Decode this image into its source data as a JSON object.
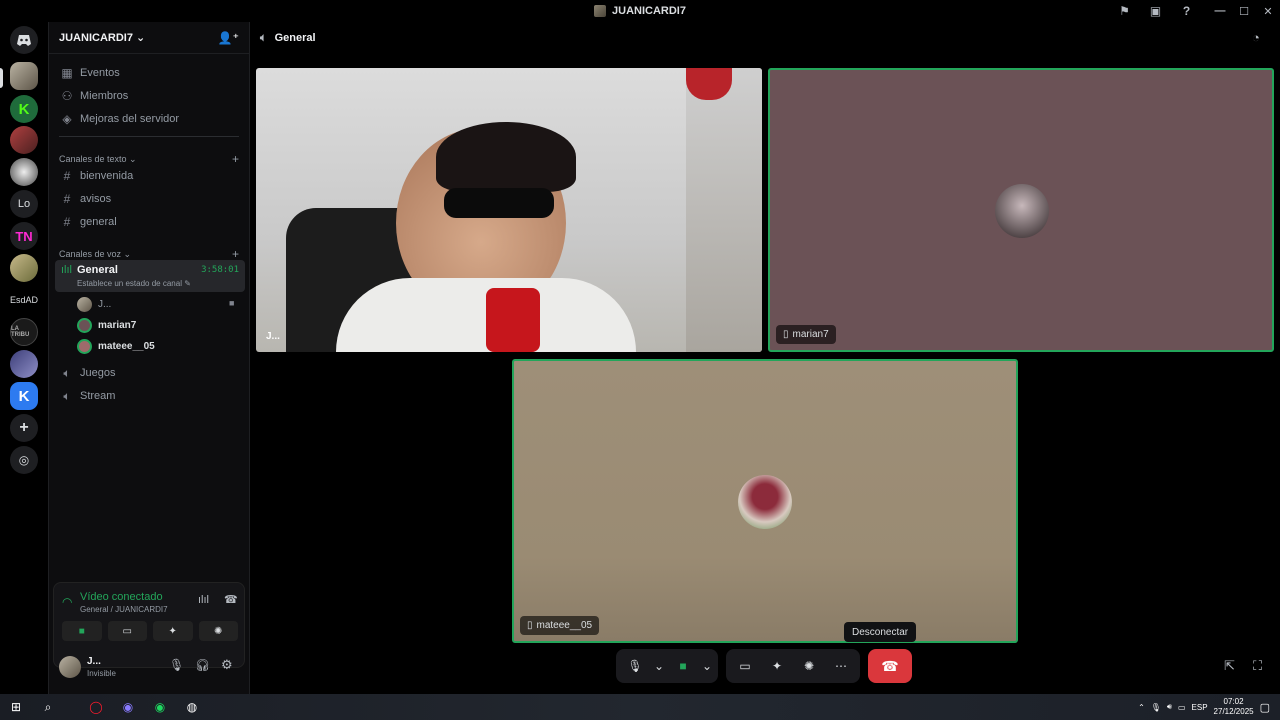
{
  "window": {
    "title": "JUANICARDI7"
  },
  "servers": {
    "items": [
      "Lo",
      "EsdAD"
    ]
  },
  "guild": {
    "name": "JUANICARDI7"
  },
  "sidebar": {
    "top_items": [
      "Eventos",
      "Miembros",
      "Mejoras del servidor"
    ],
    "text_category": "Canales de texto",
    "text_channels": [
      "bienvenida",
      "avisos",
      "general"
    ],
    "voice_category": "Canales de voz",
    "voice_channel": {
      "name": "General",
      "timer": "3:58:01",
      "status": "Establece un estado de canal"
    },
    "voice_users": [
      "J...",
      "marian7",
      "mateee__05"
    ],
    "other_voice": [
      "Juegos",
      "Stream"
    ]
  },
  "voice_panel": {
    "status": "Vídeo conectado",
    "location": "General / JUANICARDI7"
  },
  "user": {
    "name": "J...",
    "status": "Invisible"
  },
  "header": {
    "channel": "General"
  },
  "tiles": {
    "juan": "J...",
    "marian": "marian7",
    "mateee": "mateee__05"
  },
  "tooltip": "Desconectar",
  "taskbar": {
    "lang": "ESP",
    "time": "07:02",
    "date": "27/12/2025"
  },
  "colors": {
    "accent_green": "#23a55a",
    "disconnect": "#da373c",
    "tile_marian": "#6b5256",
    "tile_mateee": "#9e8f78"
  }
}
